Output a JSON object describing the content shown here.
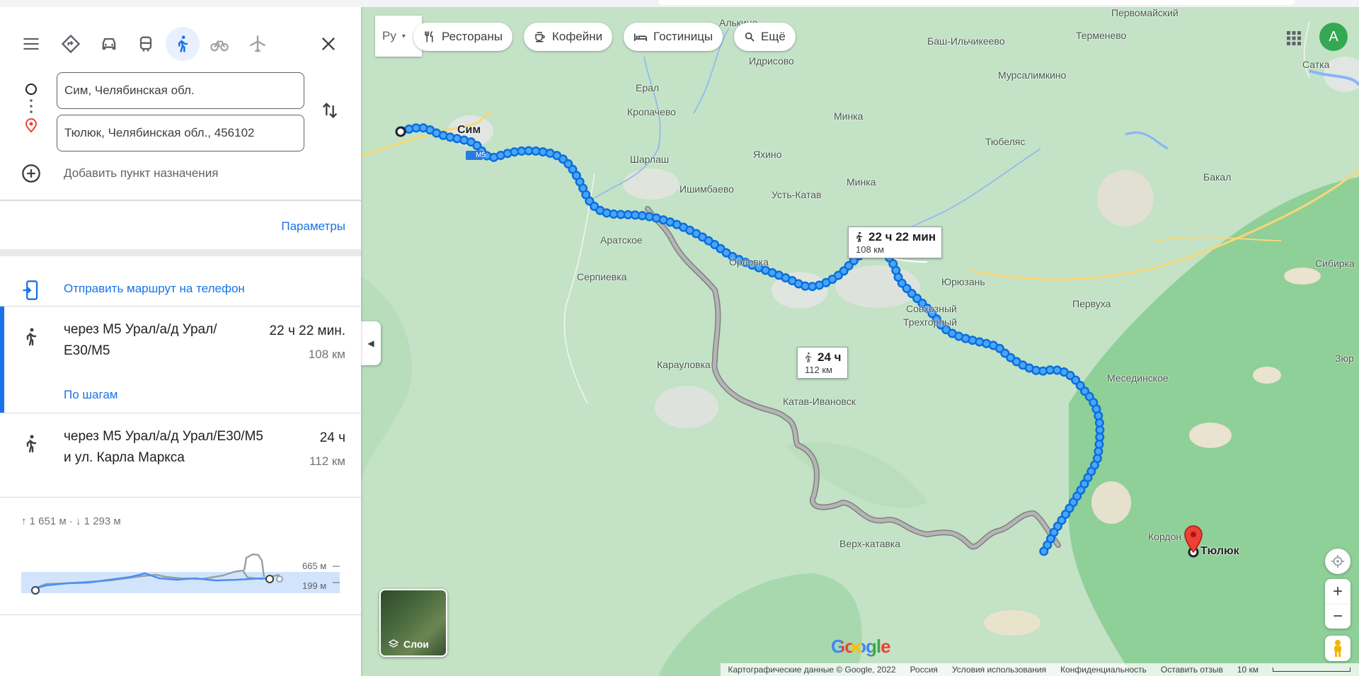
{
  "panel": {
    "origin": "Сим, Челябинская обл.",
    "destination": "Тюлюк, Челябинская обл., 456102",
    "add_destination": "Добавить пункт назначения",
    "params": "Параметры",
    "send_to_phone": "Отправить маршрут на телефон",
    "travel_modes": [
      "menu-icon",
      "best-route-icon",
      "car-icon",
      "transit-icon",
      "walk-icon",
      "bike-icon",
      "flight-icon"
    ],
    "active_mode": "walk",
    "routes": [
      {
        "title_line1": "через М5 Урал/а/д Урал/",
        "title_line2": "E30/M5",
        "time": "22 ч 22 мин.",
        "distance": "108 км",
        "steps": "По шагам",
        "selected": true
      },
      {
        "title_line1": "через М5 Урал/а/д Урал/E30/M5",
        "title_line2": "и ул. Карла Маркса",
        "time": "24 ч",
        "distance": "112 км",
        "selected": false
      }
    ],
    "elevation": {
      "summary": "↑ 1 651 м · ↓ 1 293 м",
      "max": "665 м",
      "min": "199 м"
    }
  },
  "map": {
    "lang": "Ру",
    "chips": [
      "Рестораны",
      "Кофейни",
      "Гостиницы",
      "Ещё"
    ],
    "avatar_letter": "A",
    "route_labels": [
      {
        "time": "22 ч 22 мин",
        "distance": "108 км"
      },
      {
        "time": "24 ч",
        "distance": "112 км"
      }
    ],
    "road_badge": "M5",
    "places": {
      "sim": "Сим",
      "tyulyuk": "Тюлюк",
      "alkino": "Алькино",
      "pervomaysky": "Первомайский",
      "bash_ilchikeevo": "Баш-Ильчикеево",
      "termenevo": "Терменево",
      "idrisovo": "Идрисово",
      "satka": "Сатка",
      "eral": "Ерал",
      "mursalimkino": "Мурсалимкино",
      "kropachevo": "Кропачево",
      "minka1": "Минка",
      "tyubelyas": "Тюбеляс",
      "sharlash": "Шарлаш",
      "yakhino": "Яхино",
      "bakal": "Бакал",
      "ishimbaevo": "Ишимбаево",
      "ust_katav": "Усть-Катав",
      "minka2": "Минка",
      "aratskoe": "Аратское",
      "sibirka": "Сибирка",
      "orlovka": "Орловка",
      "serpievka": "Серпиевка",
      "yuryuzan": "Юрюзань",
      "sovkhozny": "Совхозный",
      "pervukha": "Первуха",
      "trekhgorny": "Трехгорный",
      "zyur": "Зюр",
      "karaulovka": "Карауловка",
      "mesedinskoe": "Месединское",
      "katav_ivanovsk": "Катав-Ивановск",
      "verkh_katavka": "Верх-катавка",
      "kordon": "Кордон"
    },
    "layers": "Слои",
    "logo": "Google",
    "attribution": [
      "Картографические данные © Google, 2022",
      "Россия",
      "Условия использования",
      "Конфиденциальность",
      "Оставить отзыв",
      "10 км"
    ]
  }
}
